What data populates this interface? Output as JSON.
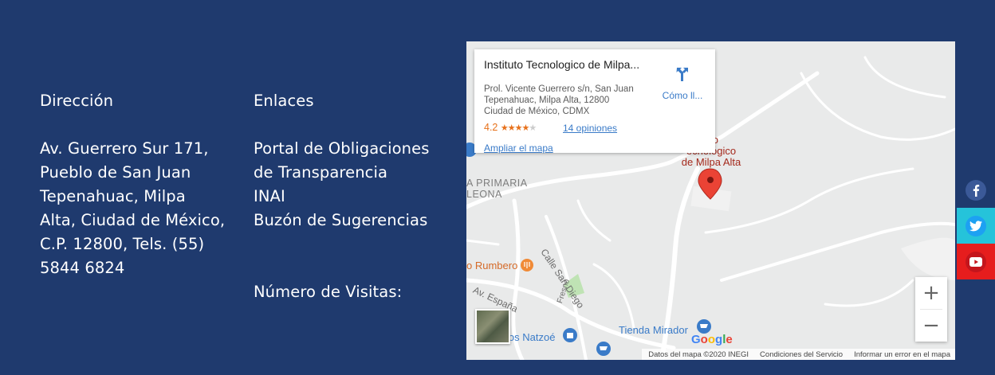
{
  "address": {
    "heading": "Dirección",
    "lines": [
      "Av. Guerrero Sur 171,",
      "Pueblo de San Juan",
      "Tepenahuac, Milpa",
      "Alta, Ciudad de México,",
      "C.P. 12800, Tels. (55)",
      "5844 6824"
    ]
  },
  "links": {
    "heading": "Enlaces",
    "items": [
      "Portal de Obligaciones",
      "de Transparencia",
      "INAI",
      "Buzón de Sugerencias"
    ],
    "visits_label": "Número de Visitas:"
  },
  "map": {
    "card": {
      "title": "Instituto Tecnologico de Milpa...",
      "address_lines": [
        "Prol. Vicente Guerrero s/n, San Juan",
        "Tepenahuac, Milpa Alta, 12800",
        "Ciudad de México, CDMX"
      ],
      "rating": "4.2",
      "stars_filled": "★★★★",
      "stars_empty": "★",
      "reviews": "14 opiniones",
      "enlarge": "Ampliar el mapa",
      "directions": "Cómo ll..."
    },
    "labels": {
      "poi_title": [
        "uto",
        "ecnológico",
        "de Milpa Alta"
      ],
      "school": [
        "A PRIMARIA",
        "LEONA"
      ],
      "calle_san_diego": "Calle San Diego",
      "rumbero": "o Rumbero",
      "av_espana": "Av. España",
      "fresno": "Fresno",
      "tienda": "Tienda Mirador",
      "natzoe": "los Natzoé",
      "google": "Google"
    },
    "footer": [
      "Datos del mapa ©2020 INEGI",
      "Condiciones del Servicio",
      "Informar un error en el mapa"
    ],
    "zoom_in": "+",
    "zoom_out": "−"
  },
  "social": {
    "icons": [
      "facebook-icon",
      "twitter-icon",
      "youtube-icon"
    ],
    "colors": {
      "facebook": "#1f3a6e",
      "twitter": "#25c3da",
      "youtube": "#e61d1d"
    }
  }
}
